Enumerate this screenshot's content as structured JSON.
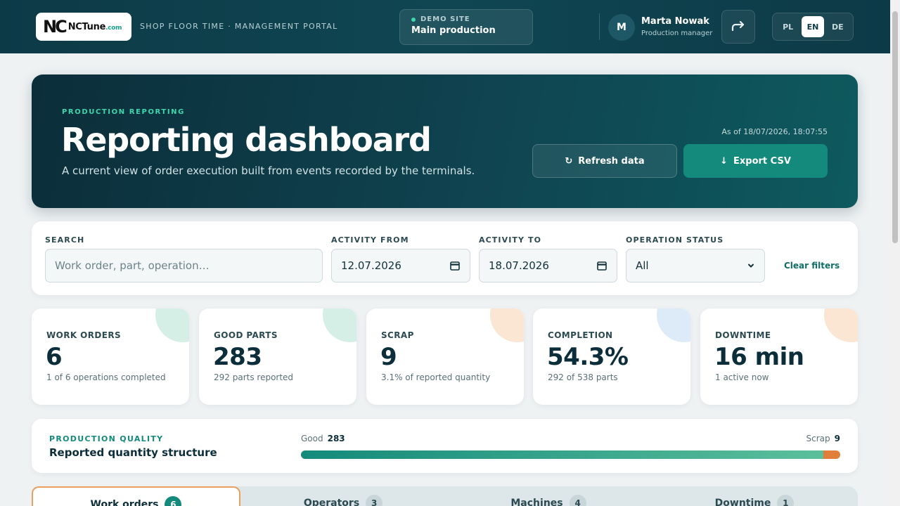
{
  "header": {
    "logo_mark": "NC",
    "logo_name": "NCTune",
    "logo_domain": ".com",
    "portal_title": "SHOP FLOOR TIME · MANAGEMENT PORTAL",
    "site_label": "DEMO SITE",
    "site_name": "Main production",
    "user_initial": "M",
    "user_name": "Marta Nowak",
    "user_role": "Production manager",
    "languages": [
      "PL",
      "EN",
      "DE"
    ],
    "active_language": "EN"
  },
  "hero": {
    "eyebrow": "PRODUCTION REPORTING",
    "title": "Reporting dashboard",
    "subtitle": "A current view of order execution built from events recorded by the terminals.",
    "as_of": "As of 18/07/2026, 18:07:55",
    "refresh_label": "Refresh data",
    "export_label": "Export CSV"
  },
  "filters": {
    "search_label": "SEARCH",
    "search_placeholder": "Work order, part, operation…",
    "from_label": "ACTIVITY FROM",
    "from_value": "12.07.2026",
    "to_label": "ACTIVITY TO",
    "to_value": "18.07.2026",
    "status_label": "OPERATION STATUS",
    "status_value": "All",
    "clear_label": "Clear filters"
  },
  "kpis": [
    {
      "label": "WORK ORDERS",
      "value": "6",
      "note": "1 of 6 operations completed",
      "accent": "#d6efe6"
    },
    {
      "label": "GOOD PARTS",
      "value": "283",
      "note": "292 parts reported",
      "accent": "#d6efe6"
    },
    {
      "label": "SCRAP",
      "value": "9",
      "note": "3.1% of reported quantity",
      "accent": "#fbe5d3"
    },
    {
      "label": "COMPLETION",
      "value": "54.3%",
      "note": "292 of 538 parts",
      "accent": "#dcebf7"
    },
    {
      "label": "DOWNTIME",
      "value": "16 min",
      "note": "1 active now",
      "accent": "#fbe5d3"
    }
  ],
  "quality": {
    "eyebrow": "PRODUCTION QUALITY",
    "title": "Reported quantity structure",
    "good_label": "Good",
    "good_value": "283",
    "scrap_label": "Scrap",
    "scrap_value": "9",
    "good_fraction": 0.969
  },
  "tabs": [
    {
      "label": "Work orders",
      "count": "6"
    },
    {
      "label": "Operators",
      "count": "3"
    },
    {
      "label": "Machines",
      "count": "4"
    },
    {
      "label": "Downtime",
      "count": "1"
    }
  ],
  "colors": {
    "brand_dark": "#0d3a47",
    "accent_teal": "#138a7b",
    "scrap_orange": "#e07e3a",
    "active_tab_border": "#e8a05e"
  }
}
